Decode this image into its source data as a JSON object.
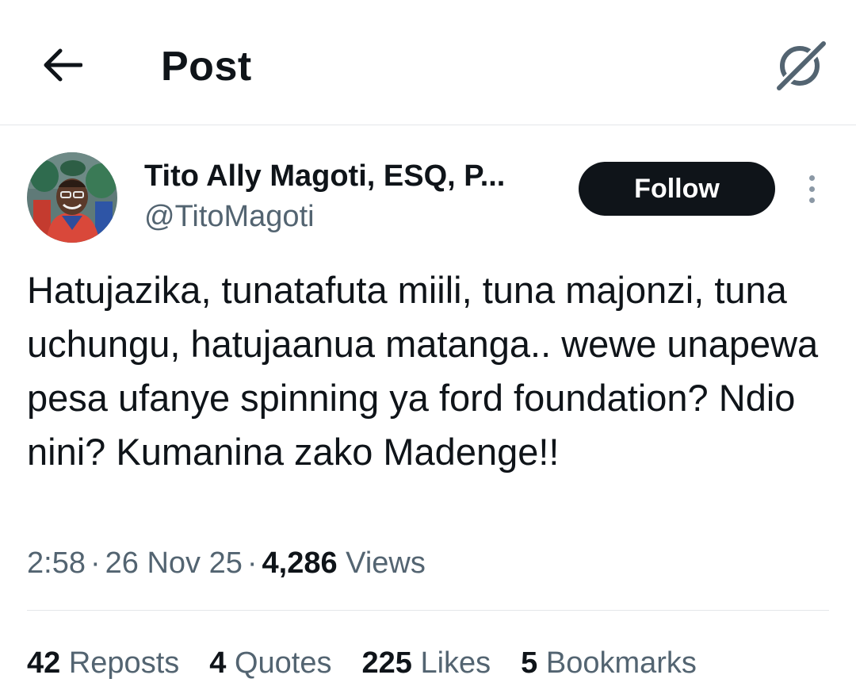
{
  "header": {
    "title": "Post",
    "back_icon": "arrow-left-icon",
    "grok_icon": "grok-icon"
  },
  "author": {
    "name": "Tito Ally Magoti, ESQ, P...",
    "handle": "@TitoMagoti",
    "follow_label": "Follow",
    "more_icon": "more-vertical-icon"
  },
  "post": {
    "text": "Hatujazika, tunatafuta miili, tuna majonzi, tuna uchungu, hatujaanua matanga.. wewe unapewa pesa ufanye spinning ya ford foundation? Ndio nini? Kumanina zako Madenge!!",
    "time": "2:58",
    "date": "26 Nov 25",
    "separator": "·",
    "views_count": "4,286",
    "views_label": "Views"
  },
  "stats": [
    {
      "count": "42",
      "label": "Reposts"
    },
    {
      "count": "4",
      "label": "Quotes"
    },
    {
      "count": "225",
      "label": "Likes"
    },
    {
      "count": "5",
      "label": "Bookmarks"
    }
  ],
  "colors": {
    "text_primary": "#0f1419",
    "text_secondary": "#536471",
    "divider": "#e4e7ea",
    "follow_bg": "#0f1419",
    "follow_text": "#ffffff"
  }
}
